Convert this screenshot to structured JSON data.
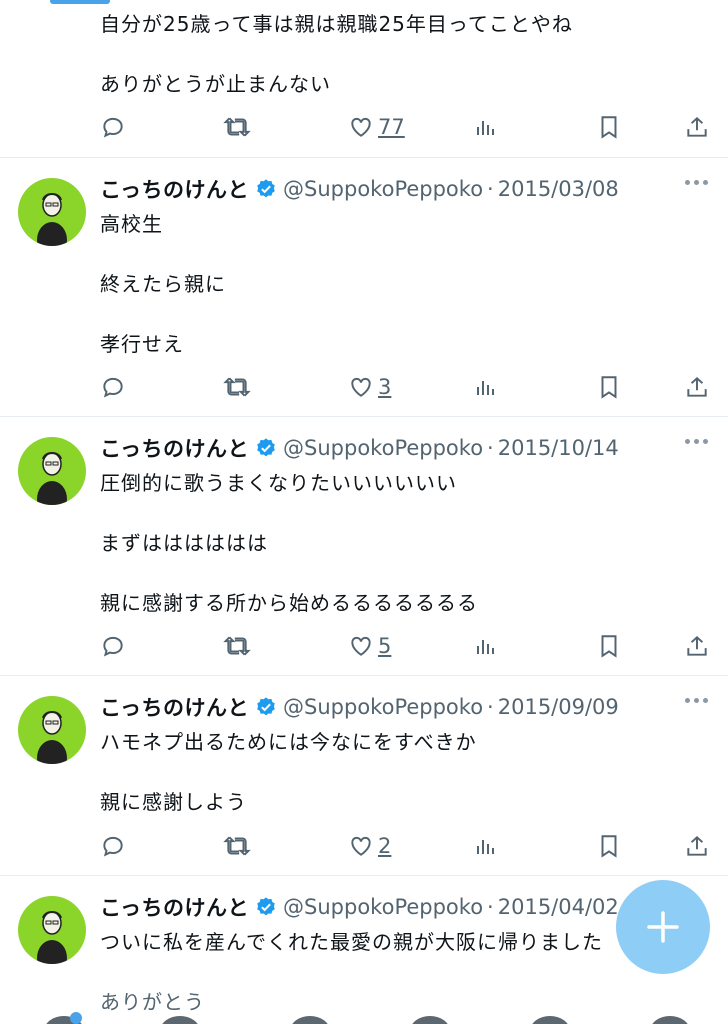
{
  "top_tweet": {
    "lines": [
      "自分が25歳って事は親は親職25年目ってことやね",
      "ありがとうが止まんない"
    ],
    "like_count": "77"
  },
  "author": {
    "name": "こっちのけんと",
    "handle": "@SuppokoPeppoko"
  },
  "separator": "·",
  "tweets": [
    {
      "date": "2015/03/08",
      "lines": [
        "高校生",
        "終えたら親に",
        "孝行せえ"
      ],
      "like_count": "3"
    },
    {
      "date": "2015/10/14",
      "lines": [
        "圧倒的に歌うまくなりたいいいいいい",
        "まずはははははは",
        "親に感謝する所から始めるるるるるるる"
      ],
      "like_count": "5"
    },
    {
      "date": "2015/09/09",
      "lines": [
        "ハモネプ出るためには今なにをすべきか",
        "親に感謝しよう"
      ],
      "like_count": "2"
    },
    {
      "date": "2015/04/02",
      "lines": [
        "ついに私を産んでくれた最愛の親が大阪に帰りました",
        "ありがとう"
      ],
      "like_count": ""
    }
  ],
  "colors": {
    "accent": "#1d9bf0",
    "avatar_bg": "#8bd42a",
    "fab": "#8ecdf6",
    "muted": "#536471"
  }
}
